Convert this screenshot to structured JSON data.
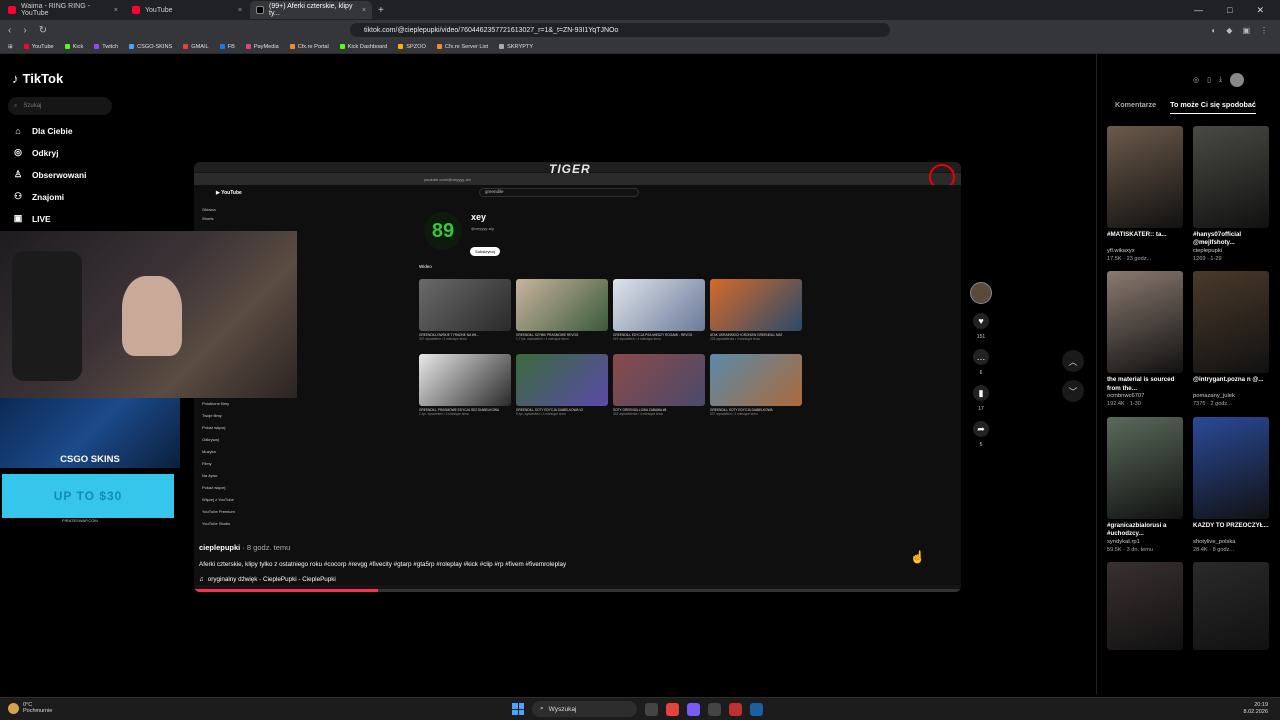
{
  "browser": {
    "tabs": [
      {
        "title": "Waima - RING RING - YouTube",
        "active": false,
        "icon": "youtube-icon"
      },
      {
        "title": "YouTube",
        "active": false,
        "icon": "youtube-icon"
      },
      {
        "title": "(99+) Aferki czterskie, klipy ty...",
        "active": true,
        "icon": "tiktok-icon"
      }
    ],
    "url": "tiktok.com/@cieplepupki/video/7604462357721613027_r=1&_t=ZN-93I1YqTJNOo",
    "bookmarks": [
      "YouTube",
      "Kick",
      "Twitch",
      "CSGO-SKINS",
      "GMAIL",
      "FB",
      "PayMedia",
      "Cfx.re Portal",
      "Kick Dashboard",
      "SPZOO",
      "Cfx.re Server List",
      "SKRYPTY"
    ]
  },
  "tiktok": {
    "logo": "TikTok",
    "search_placeholder": "Szukaj",
    "menu": [
      {
        "label": "Dla Ciebie",
        "icon": "home-icon"
      },
      {
        "label": "Odkryj",
        "icon": "compass-icon"
      },
      {
        "label": "Obserwowani",
        "icon": "user-icon"
      },
      {
        "label": "Znajomi",
        "icon": "users-icon"
      },
      {
        "label": "LIVE",
        "icon": "live-icon"
      }
    ]
  },
  "overlay": {
    "csgo_label": "CSGO SKINS",
    "pirate_label": "UP TO $30",
    "pirate_sub": "PIRATESWAP.COM"
  },
  "video": {
    "tiger_label": "TIGER",
    "inner_url": "youtube.com/@xeyyyy-a/v",
    "inner_search": "greendile",
    "channel_name": "xey",
    "channel_handle": "@xeyyyy-a/y",
    "subscribe_label": "Subskrybuj",
    "videos_tab": "Wideo",
    "leftnav_top": [
      "Główna",
      "Shorts"
    ],
    "leftnav_bottom": [
      "Polubione filmy",
      "Twoje filmy",
      "Pokaż więcej",
      "Odkrywaj",
      "Muzyka",
      "Filmy",
      "Na żywo",
      "Pokaż więcej",
      "Więcej z YouTube",
      "YouTube Premium",
      "YouTube Studio"
    ],
    "cards": [
      {
        "title": "GREENDILLOWSKIE TYRADNE NA WŁ...",
        "meta": "307 wyświetleń • 3 miesiące temu"
      },
      {
        "title": "GREENDILL SZYBKI PRASMOWE REVOG",
        "meta": "1,7 tys. wyświetleń • 4 miesiące temu"
      },
      {
        "title": "GREENDILL EDYCJA PSA MIEDZY ROGAMI - REVOG",
        "meta": "519 wyświetleń • 4 miesiące temu"
      },
      {
        "title": "ATAK UKRAINSKICH DRONOW GREENDILL MAT",
        "meta": "233 wyświetlenia • 4 miesiące temu"
      },
      {
        "title": "GREENDILL PRASMOWE EDYCJA SEZ DIABELKOWA",
        "meta": "1 tys. wyświetleń • 4 miesiące temu"
      },
      {
        "title": "GREENDILL SOTY EDYCJA DIABELKOWA V2",
        "meta": "5 tys. wyświetleń • 4 miesiące temu"
      },
      {
        "title": "SOTY GREENDILLOWA ZABAWA #8",
        "meta": "442 wyświetlenia • 4 miesiące temu"
      },
      {
        "title": "GREENDILL SOTY EDYCJA DIABELKOWA",
        "meta": "537 wyświetleń • 4 miesiące temu"
      }
    ],
    "author": "cieplepupki",
    "time": " · 8 godz. temu",
    "description": "Aferki czterskie, klipy tylko z ostatniego roku #cocorp #revgg #fivecity #gtarp #gta5rp #roleplay #kick #clip #rp #fivem #fivemroleplay",
    "music": "oryginalny dźwięk - CieplePupki - CieplePupki",
    "progress": 0.24
  },
  "actions": {
    "likes": "151",
    "comments": "6",
    "saves": "17",
    "shares": "5"
  },
  "right_panel": {
    "tabs": [
      "Komentarze",
      "To może Ci się spodobać"
    ],
    "active_tab": 1,
    "items": [
      {
        "title": "#MATISKATER:: ta...",
        "author": "yfl.wikaxyx",
        "stats": "17.5K · 23 godz...",
        "color": "#6b5a4a"
      },
      {
        "title": "#hanys07official @mejlfshoty...",
        "author": "cieplepupki",
        "stats": "1269 · 1-29",
        "color": "#4a4a44"
      },
      {
        "title": "the material is sourced from the...",
        "author": "ocmbnwc6707",
        "stats": "192.4K · 1-30",
        "color": "#8a7a70"
      },
      {
        "title": "@intrygant.pozna n @...",
        "author": "pomazany_julek",
        "stats": "7375 · 2 godz...",
        "color": "#4a3a2a"
      },
      {
        "title": "#granicazbialorusi a #uchodzcy...",
        "author": "syndykat.rp1",
        "stats": "59.5K · 3 dn. temu",
        "color": "#5a6a5a"
      },
      {
        "title": "KAŻDY TO PRZEOCZYŁ...",
        "author": "shotylive_polska",
        "stats": "28.4K · 8 godz...",
        "color": "#2a4a9a"
      },
      {
        "title": "",
        "author": "",
        "stats": "",
        "color": "#3a3030"
      },
      {
        "title": "",
        "author": "",
        "stats": "",
        "color": "#2a2a2a"
      }
    ]
  },
  "taskbar": {
    "weather_temp": "0°C",
    "weather_desc": "Pochmurnie",
    "search_label": "Wyszukaj",
    "time": "20:19",
    "date": "8.02.2026"
  }
}
